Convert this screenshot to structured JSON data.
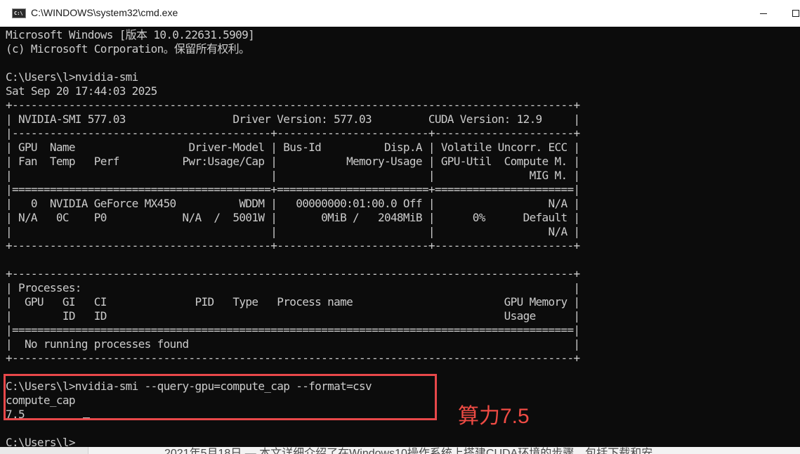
{
  "window": {
    "title": "C:\\WINDOWS\\system32\\cmd.exe",
    "icon_name": "console-app-icon"
  },
  "terminal": {
    "lines": [
      "Microsoft Windows [版本 10.0.22631.5909]",
      "(c) Microsoft Corporation。保留所有权利。",
      "",
      "C:\\Users\\l>nvidia-smi",
      "Sat Sep 20 17:44:03 2025",
      "+-----------------------------------------------------------------------------------------+",
      "| NVIDIA-SMI 577.03                 Driver Version: 577.03         CUDA Version: 12.9     |",
      "|-----------------------------------------+------------------------+----------------------+",
      "| GPU  Name                  Driver-Model | Bus-Id          Disp.A | Volatile Uncorr. ECC |",
      "| Fan  Temp   Perf          Pwr:Usage/Cap |           Memory-Usage | GPU-Util  Compute M. |",
      "|                                         |                        |               MIG M. |",
      "|=========================================+========================+======================|",
      "|   0  NVIDIA GeForce MX450          WDDM |   00000000:01:00.0 Off |                  N/A |",
      "| N/A   0C    P0            N/A  /  5001W |       0MiB /   2048MiB |      0%      Default |",
      "|                                         |                        |                  N/A |",
      "+-----------------------------------------+------------------------+----------------------+",
      "",
      "+-----------------------------------------------------------------------------------------+",
      "| Processes:                                                                              |",
      "|  GPU   GI   CI              PID   Type   Process name                        GPU Memory |",
      "|        ID   ID                                                               Usage      |",
      "|=========================================================================================|",
      "|  No running processes found                                                             |",
      "+-----------------------------------------------------------------------------------------+",
      "",
      "C:\\Users\\l>nvidia-smi --query-gpu=compute_cap --format=csv",
      "compute_cap",
      "7.5",
      "",
      "C:\\Users\\l>"
    ]
  },
  "annotation": {
    "text": "算力7.5",
    "color": "#ef4b44"
  },
  "background_window": {
    "partial_text": "2021年5月18日 — 本文详细介绍了在Windows10操作系统上搭建CUDA环境的步骤，包括下载和安"
  }
}
